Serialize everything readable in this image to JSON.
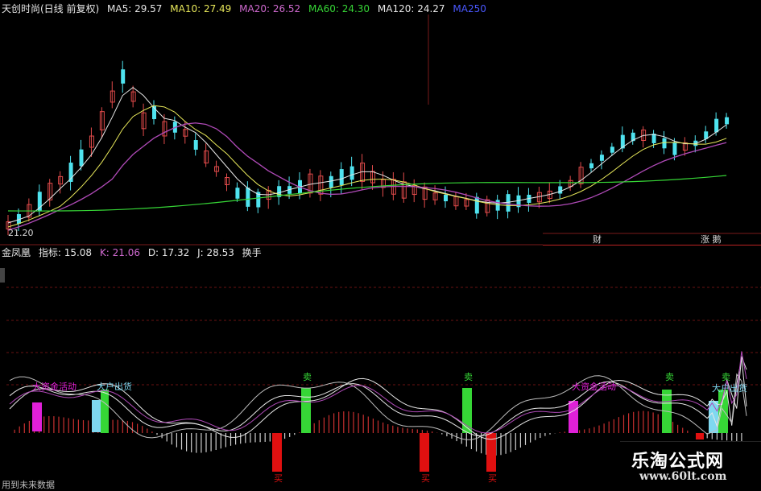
{
  "header": {
    "title": "天创时尚(日线 前复权)",
    "items": [
      {
        "label": "MA5: 29.57",
        "color": "#e6e6e6"
      },
      {
        "label": "MA10: 27.49",
        "color": "#e8e85a"
      },
      {
        "label": "MA20: 26.52",
        "color": "#d06ad0"
      },
      {
        "label": "MA60: 24.30",
        "color": "#36d636"
      },
      {
        "label": "MA120: 24.27",
        "color": "#e6e6e6"
      },
      {
        "label": "MA250",
        "color": "#4a58ff"
      }
    ]
  },
  "price_low_label": "21.20",
  "side_labels": {
    "left": "财",
    "right": "涨 鹅"
  },
  "indicator": {
    "name": "金凤凰",
    "items": [
      {
        "label": "指标: 15.08",
        "color": "#e6e6e6"
      },
      {
        "label": "K: 21.06",
        "color": "#d06ad0"
      },
      {
        "label": "D: 17.32",
        "color": "#e6e6e6"
      },
      {
        "label": "J: 28.53",
        "color": "#e6e6e6"
      },
      {
        "label": "换手",
        "color": "#e6e6e6"
      }
    ]
  },
  "signals": {
    "buy_zhuli_1": "大资金活动",
    "sell_dahu_1": "大户出货",
    "sell_1": "卖",
    "sell_2": "卖",
    "buy_zhuli_2": "大资金活动",
    "sell_3": "卖",
    "sell_4": "卖",
    "sell_dahu_2": "大户出货",
    "bottom_1": "买",
    "bottom_2": "买",
    "bottom_3": "买"
  },
  "footer_note": "用到未来数据",
  "brand": {
    "name": "乐淘公式网",
    "url": "www.60lt.com"
  },
  "colors": {
    "up": "#e34b4b",
    "down": "#4fe3ef",
    "ma5": "#e6e6e6",
    "ma10": "#e8e85a",
    "ma20": "#b04ab8",
    "ma60": "#36d636",
    "buy": "#36d636",
    "sell": "#e01010",
    "pink": "#e020d8",
    "cyan": "#7fd8f0"
  }
}
